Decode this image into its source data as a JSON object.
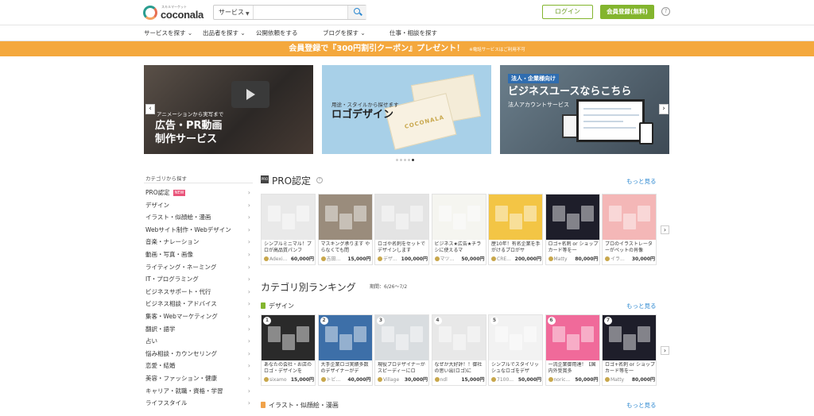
{
  "header": {
    "logo_tagline": "スキルマーケット",
    "logo_text": "coconala",
    "search_select": "サービス",
    "search_placeholder": "",
    "login_label": "ログイン",
    "register_label": "会員登録(無料)",
    "help_label": "?"
  },
  "nav": [
    "サービスを探す ⌄",
    "出品者を探す ⌄",
    "公開依頼をする",
    "ブログを探す ⌄",
    "仕事・相談を探す"
  ],
  "banner": {
    "main": "会員登録で『300円割引クーポン』プレゼント！",
    "note": "※電話サービスはご利用不可"
  },
  "hero": [
    {
      "small": "アニメーションから実写まで",
      "big1": "広告・PR動画",
      "big2": "制作サービス"
    },
    {
      "small": "用途・スタイルから探せます",
      "big1": "ロゴデザイン",
      "card_text": "COCONALA"
    },
    {
      "tag": "法人・企業様向け",
      "big1": "ビジネスユースならこちら",
      "small": "法人アカウントサービス"
    }
  ],
  "sidebar": {
    "heading": "カテゴリから探す",
    "new_badge": "NEW",
    "items": [
      "PRO認定",
      "デザイン",
      "イラスト・似顔絵・漫画",
      "Webサイト制作・Webデザイン",
      "音楽・ナレーション",
      "動画・写真・画像",
      "ライティング・ネーミング",
      "IT・プログラミング",
      "ビジネスサポート・代行",
      "ビジネス相談・アドバイス",
      "集客・Webマーケティング",
      "翻訳・語学",
      "占い",
      "悩み相談・カウンセリング",
      "恋愛・結婚",
      "美容・ファッション・健康",
      "キャリア・就職・資格・学習",
      "ライフスタイル"
    ]
  },
  "pro": {
    "icon_label": "PRO",
    "title": "PRO認定",
    "more": "もっと見る",
    "cards": [
      {
        "title": "シンプルミニマル！プロが高品質パンフ",
        "user": "Adexi...",
        "price": "60,000円",
        "color": "#e9e9e9"
      },
      {
        "title": "マスキング承ります やらなくても問",
        "user": "吉田...",
        "price": "15,000円",
        "color": "#9a8c7c"
      },
      {
        "title": "ロゴや名刺をセットでデザインします",
        "user": "デザ...",
        "price": "100,000円",
        "color": "#e4e4e4"
      },
      {
        "title": "ビジネス★広告★チラシに使えるマ",
        "user": "マツ...",
        "price": "50,000円",
        "color": "#f5f5f0"
      },
      {
        "title": "歴10年！有名企業を手がけるプロがサ",
        "user": "CRE...",
        "price": "200,000円",
        "color": "#f3c545"
      },
      {
        "title": "ロゴ+名刺 or ショップカード等を一",
        "user": "Matty",
        "price": "80,000円",
        "color": "#1e1e2a"
      },
      {
        "title": "プロのイラストレーターがペットの肖像",
        "user": "イラ...",
        "price": "30,000円",
        "color": "#f4b7b7"
      }
    ]
  },
  "ranking": {
    "title": "カテゴリ別ランキング",
    "period": "期間：6/26〜7/2",
    "more": "もっと見る",
    "design_label": "デザイン",
    "cards": [
      {
        "rank": "1",
        "title": "あなたの会社・お店のロゴ・デザインを",
        "user": "sixamo",
        "price": "15,000円",
        "color": "#2a2a2a"
      },
      {
        "rank": "2",
        "title": "大手企業ロゴ実績多数のデザイナーがデ",
        "user": "トビ...",
        "price": "40,000円",
        "color": "#3d6fa8"
      },
      {
        "rank": "3",
        "title": "現役プロデザイナーがスピーディーにロ",
        "user": "Village",
        "price": "30,000円",
        "color": "#d9dde0"
      },
      {
        "rank": "4",
        "title": "なぜか大好評！！御社の思い出(ロゴ)に",
        "user": "ndl",
        "price": "15,000円",
        "color": "#e8e8e8"
      },
      {
        "rank": "5",
        "title": "シンプルでスタイリッシュなロゴをデザ",
        "user": "7100...",
        "price": "50,000円",
        "color": "#f2f2f2"
      },
      {
        "rank": "6",
        "title": "一流企業御用達！【国内外受賞多",
        "user": "noric...",
        "price": "50,000円",
        "color": "#f06a9a"
      },
      {
        "rank": "7",
        "title": "ロゴ+名刺 or ショップカード等を一",
        "user": "Matty",
        "price": "80,000円",
        "color": "#1e1e2a"
      }
    ]
  },
  "illust_label": "イラスト・似顔絵・漫画",
  "illust_more": "もっと見る",
  "arrows": {
    "left": "‹",
    "right": "›"
  }
}
